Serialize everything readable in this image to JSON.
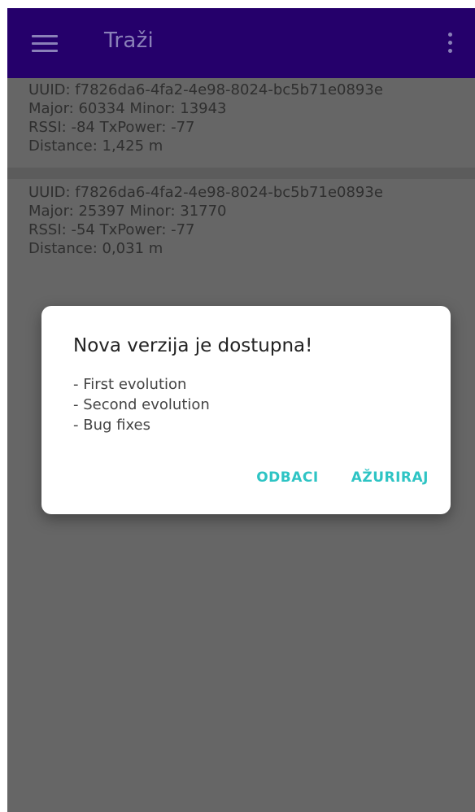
{
  "appbar": {
    "title": "Traži"
  },
  "beacons": [
    {
      "uuid_line": "UUID: f7826da6-4fa2-4e98-8024-bc5b71e0893e",
      "major_minor_line": "Major: 60334 Minor: 13943",
      "rssi_line": "RSSI: -84 TxPower: -77",
      "distance_line": "Distance: 1,425 m"
    },
    {
      "uuid_line": "UUID: f7826da6-4fa2-4e98-8024-bc5b71e0893e",
      "major_minor_line": "Major: 25397 Minor: 31770",
      "rssi_line": "RSSI: -54 TxPower: -77",
      "distance_line": "Distance: 0,031 m"
    }
  ],
  "dialog": {
    "title": "Nova verzija je dostupna!",
    "notes": [
      "- First evolution",
      "- Second evolution",
      "- Bug fixes"
    ],
    "dismiss_label": "ODBACI",
    "update_label": "AŽURIRAJ"
  },
  "colors": {
    "appbar": "#25006b",
    "accent": "#2ec4c4",
    "scrim_background": "#666666"
  },
  "icons": {
    "menu": "hamburger-menu-icon",
    "more": "more-vertical-icon"
  }
}
